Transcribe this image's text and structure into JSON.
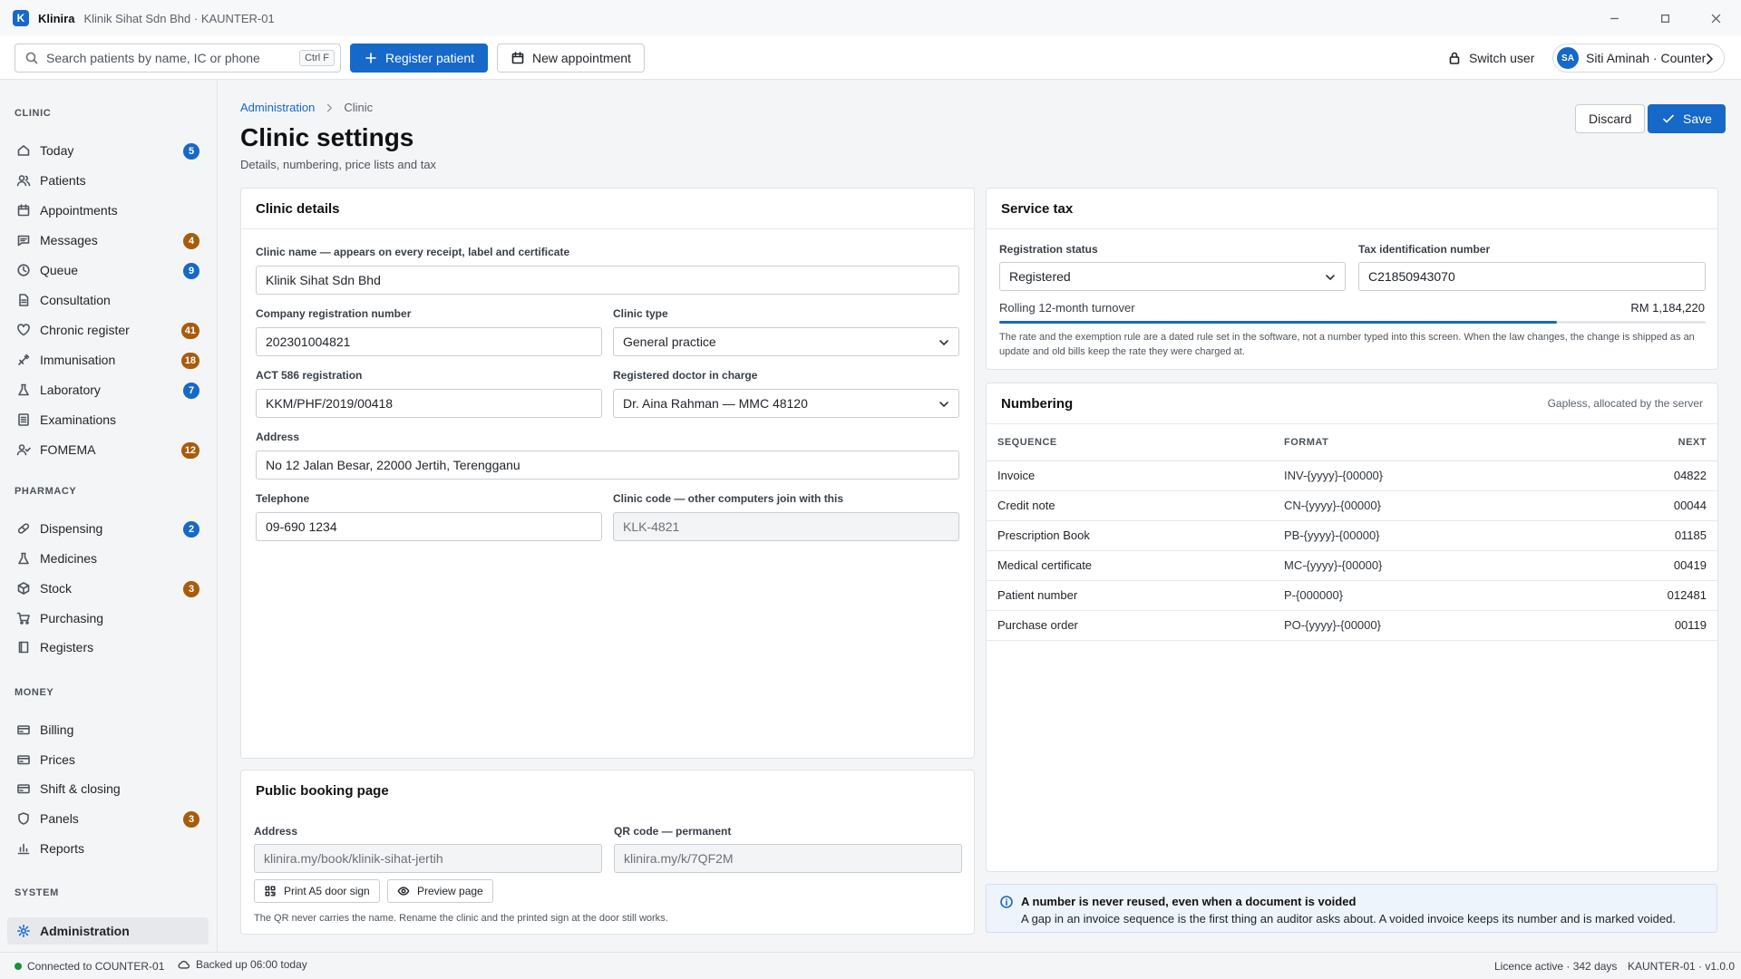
{
  "window": {
    "app_name": "Klinira",
    "app_logo": "K",
    "subtitle": "Klinik Sihat Sdn Bhd · KAUNTER-01"
  },
  "toolbar": {
    "search_placeholder": "Search patients by name, IC or phone",
    "search_shortcut": "Ctrl F",
    "register_label": "Register patient",
    "appointment_label": "New appointment",
    "switch_user_label": "Switch user",
    "user_initials": "SA",
    "user_name": "Siti Aminah · Counter"
  },
  "sidebar": {
    "sections": {
      "clinic": "CLINIC",
      "pharmacy": "PHARMACY",
      "money": "MONEY",
      "system": "SYSTEM"
    },
    "items": [
      {
        "label": "Today",
        "badge": "5",
        "badge_color": "#1668c9"
      },
      {
        "label": "Patients",
        "badge": ""
      },
      {
        "label": "Appointments",
        "badge": ""
      },
      {
        "label": "Messages",
        "badge": "4",
        "badge_color": "#a85c0b"
      },
      {
        "label": "Queue",
        "badge": "9",
        "badge_color": "#1668c9"
      },
      {
        "label": "Consultation",
        "badge": ""
      },
      {
        "label": "Chronic register",
        "badge": "41",
        "badge_color": "#a85c0b"
      },
      {
        "label": "Immunisation",
        "badge": "18",
        "badge_color": "#a85c0b"
      },
      {
        "label": "Laboratory",
        "badge": "7",
        "badge_color": "#1668c9"
      },
      {
        "label": "Examinations",
        "badge": ""
      },
      {
        "label": "FOMEMA",
        "badge": "12",
        "badge_color": "#a85c0b"
      },
      {
        "label": "Dispensing",
        "badge": "2",
        "badge_color": "#1668c9"
      },
      {
        "label": "Medicines",
        "badge": ""
      },
      {
        "label": "Stock",
        "badge": "3",
        "badge_color": "#a85c0b"
      },
      {
        "label": "Purchasing",
        "badge": ""
      },
      {
        "label": "Registers",
        "badge": ""
      },
      {
        "label": "Billing",
        "badge": ""
      },
      {
        "label": "Prices",
        "badge": ""
      },
      {
        "label": "Shift & closing",
        "badge": ""
      },
      {
        "label": "Panels",
        "badge": "3",
        "badge_color": "#a85c0b"
      },
      {
        "label": "Reports",
        "badge": ""
      },
      {
        "label": "Administration",
        "badge": "",
        "active": true
      }
    ]
  },
  "header": {
    "breadcrumb": [
      "Administration",
      "Clinic"
    ],
    "title": "Clinic settings",
    "subtitle": "Details, numbering, price lists and tax",
    "discard_label": "Discard",
    "save_label": "Save"
  },
  "clinic_details": {
    "title": "Clinic details",
    "clinic_name_label": "Clinic name — appears on every receipt, label and certificate",
    "clinic_name": "Klinik Sihat Sdn Bhd",
    "company_reg_label": "Company registration number",
    "company_reg": "202301004821",
    "clinic_type_label": "Clinic type",
    "clinic_type": "General practice",
    "act586_label": "ACT 586 registration",
    "act586": "KKM/PHF/2019/00418",
    "doctor_label": "Registered doctor in charge",
    "doctor": "Dr. Aina Rahman — MMC 48120",
    "address_label": "Address",
    "address": "No 12 Jalan Besar, 22000 Jertih, Terengganu",
    "telephone_label": "Telephone",
    "telephone": "09-690 1234",
    "clinic_code_label": "Clinic code — other computers join with this",
    "clinic_code": "KLK-4821"
  },
  "booking": {
    "title": "Public booking page",
    "address_label": "Address",
    "address": "klinira.my/book/klinik-sihat-jertih",
    "qr_label": "QR code — permanent",
    "qr": "klinira.my/k/7QF2M",
    "print_label": "Print A5 door sign",
    "preview_label": "Preview page",
    "note": "The QR never carries the name. Rename the clinic and the printed sign at the door still works."
  },
  "service_tax": {
    "title": "Service tax",
    "status_label": "Registration status",
    "status": "Registered",
    "tin_label": "Tax identification number",
    "tin": "C21850943070",
    "turnover_label": "Rolling 12-month turnover",
    "turnover": "RM 1,184,220",
    "turnover_progress": 0.79,
    "note": "The rate and the exemption rule are a dated rule set in the software, not a number typed into this screen. When the law changes, the change is shipped as an update and old bills keep the rate they were charged at."
  },
  "numbering": {
    "title": "Numbering",
    "aside": "Gapless, allocated by the server",
    "columns": [
      "SEQUENCE",
      "FORMAT",
      "NEXT"
    ],
    "rows": [
      {
        "sequence": "Invoice",
        "format": "INV-{yyyy}-{00000}",
        "next": "04822"
      },
      {
        "sequence": "Credit note",
        "format": "CN-{yyyy}-{00000}",
        "next": "00044"
      },
      {
        "sequence": "Prescription Book",
        "format": "PB-{yyyy}-{00000}",
        "next": "01185"
      },
      {
        "sequence": "Medical certificate",
        "format": "MC-{yyyy}-{00000}",
        "next": "00419"
      },
      {
        "sequence": "Patient number",
        "format": "P-{000000}",
        "next": "012481"
      },
      {
        "sequence": "Purchase order",
        "format": "PO-{yyyy}-{00000}",
        "next": "00119"
      }
    ]
  },
  "info": {
    "title": "A number is never reused, even when a document is voided",
    "body": "A gap in an invoice sequence is the first thing an auditor asks about. A voided invoice keeps its number and is marked voided."
  },
  "status": {
    "connected": "Connected to COUNTER-01",
    "backup": "Backed up 06:00 today",
    "licence": "Licence active · 342 days",
    "version": "KAUNTER-01 · v1.0.0"
  },
  "colors": {
    "accent": "#1668c9",
    "badge_amber": "#a85c0b",
    "online": "#1e8e3e"
  }
}
